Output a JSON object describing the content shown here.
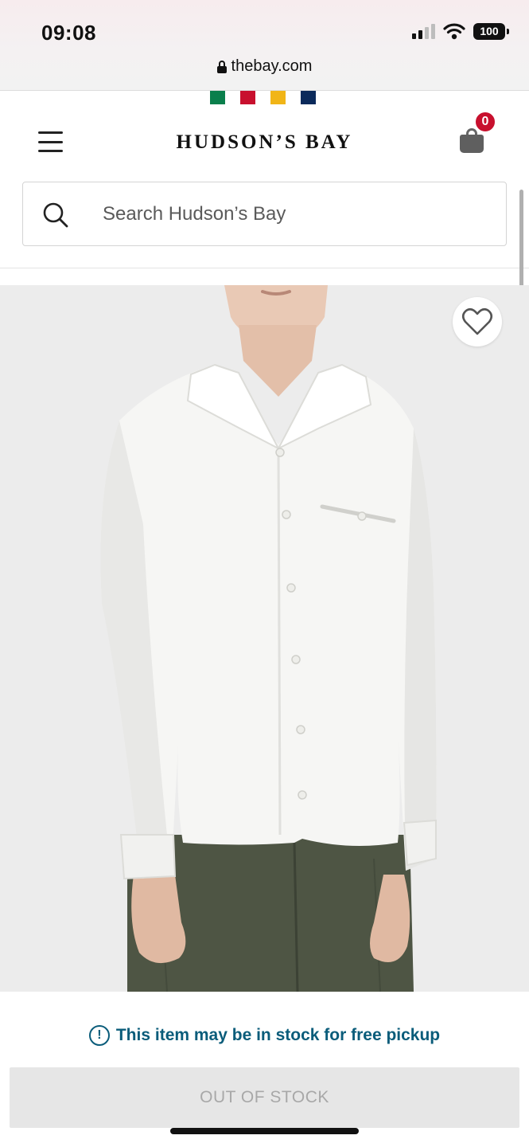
{
  "status_bar": {
    "time": "09:08",
    "battery": "100"
  },
  "browser": {
    "url": "thebay.com"
  },
  "brand": {
    "stripe_colors": [
      "#0a7f4c",
      "#c8102e",
      "#f1b517",
      "#0b2a5b"
    ],
    "logo_text": "HUDSON’S BAY"
  },
  "header": {
    "menu_icon": "hamburger-icon",
    "bag_icon": "shopping-bag-icon",
    "bag_count": "0"
  },
  "search": {
    "placeholder": "Search Hudson’s Bay",
    "value": ""
  },
  "product": {
    "image": "product-photo",
    "favorite_icon": "heart-icon"
  },
  "availability": {
    "pickup_text": "This item may be in stock for free pickup",
    "info_icon": "info-icon"
  },
  "actions": {
    "button_label": "OUT OF STOCK"
  },
  "colors": {
    "pickup_text": "#0a5c7a",
    "badge": "#c8102e",
    "button_disabled": "#e6e6e6"
  }
}
